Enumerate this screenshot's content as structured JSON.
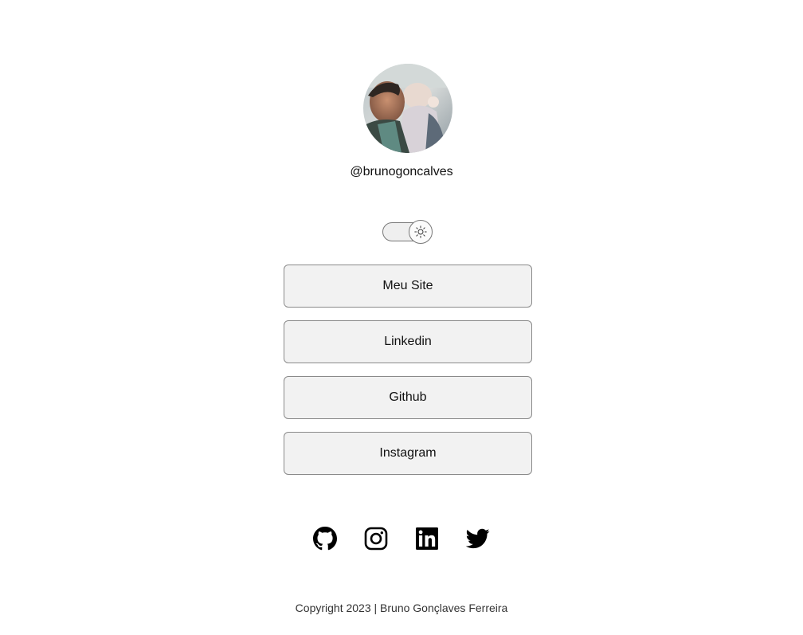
{
  "profile": {
    "handle": "@brunogoncalves"
  },
  "theme_toggle": {
    "icon": "sun-icon",
    "state": "light"
  },
  "links": [
    {
      "label": "Meu Site"
    },
    {
      "label": "Linkedin"
    },
    {
      "label": "Github"
    },
    {
      "label": "Instagram"
    }
  ],
  "social_icons": [
    "github-icon",
    "instagram-icon",
    "linkedin-icon",
    "twitter-icon"
  ],
  "footer": {
    "text": "Copyright 2023 | Bruno Gonçlaves Ferreira"
  },
  "colors": {
    "background": "#ffffff",
    "button_bg": "#f2f2f2",
    "button_border": "#8a8a8a",
    "text": "#111111"
  }
}
